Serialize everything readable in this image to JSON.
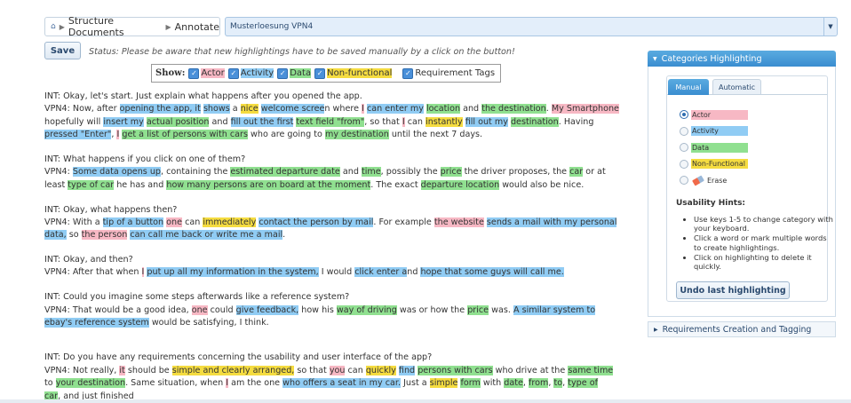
{
  "breadcrumb": {
    "home_icon": "home-icon",
    "items": [
      "Structure Documents",
      "Annotate"
    ]
  },
  "document_select": {
    "value": "Musterloesung VPN4"
  },
  "toolbar": {
    "save_label": "Save",
    "status": "Status: Please be aware that new highlightings have to be saved manually by a click on the button!"
  },
  "show": {
    "label": "Show:",
    "options": [
      "Actor",
      "Activity",
      "Data",
      "Non-functional",
      "Requirement Tags"
    ]
  },
  "colors": {
    "actor": "#f7b8c4",
    "activity": "#90ccf4",
    "data": "#90e090",
    "nonfunctional": "#f5dc40",
    "accent": "#3a8dd0"
  },
  "transcript": [
    [
      [
        "INT: Okay, let's start. Just explain what happens after you opened the app.",
        ""
      ]
    ],
    [
      [
        "VPN4: Now, after ",
        ""
      ],
      [
        "opening the app, it",
        "c"
      ],
      [
        " ",
        ""
      ],
      [
        "shows",
        "c"
      ],
      [
        " a ",
        ""
      ],
      [
        "nice",
        "n"
      ],
      [
        " ",
        ""
      ],
      [
        "welcome scree",
        "c"
      ],
      [
        "n where ",
        ""
      ],
      [
        "I",
        "a"
      ],
      [
        " ",
        ""
      ],
      [
        "can enter my",
        "c"
      ],
      [
        " ",
        ""
      ],
      [
        "location",
        "d"
      ],
      [
        " and ",
        ""
      ],
      [
        "the destination",
        "d"
      ],
      [
        ". ",
        ""
      ],
      [
        "My Smartphone",
        "a"
      ]
    ],
    [
      [
        "hopefully will ",
        ""
      ],
      [
        "insert my",
        "c"
      ],
      [
        " ",
        ""
      ],
      [
        "actual position",
        "d"
      ],
      [
        " and ",
        ""
      ],
      [
        "fill out the first",
        "c"
      ],
      [
        " ",
        ""
      ],
      [
        "text field \"from\"",
        "d"
      ],
      [
        ", so that ",
        ""
      ],
      [
        "I",
        "a"
      ],
      [
        " can ",
        ""
      ],
      [
        "instantly",
        "n"
      ],
      [
        " ",
        ""
      ],
      [
        "fill out my",
        "c"
      ],
      [
        " ",
        ""
      ],
      [
        "destination",
        "d"
      ],
      [
        ". Having",
        ""
      ]
    ],
    [
      [
        "pressed \"Enter\"",
        "c"
      ],
      [
        ", ",
        ""
      ],
      [
        "I",
        "a"
      ],
      [
        " ",
        ""
      ],
      [
        "get a list of persons with cars",
        "d"
      ],
      [
        " who are going to ",
        ""
      ],
      [
        "my destination",
        "d"
      ],
      [
        " until the next 7 days.",
        ""
      ]
    ],
    [],
    [
      [
        "INT: What happens if you click on one of them?",
        ""
      ]
    ],
    [
      [
        "VPN4: ",
        ""
      ],
      [
        "Some data opens up",
        "c"
      ],
      [
        ", containing the ",
        ""
      ],
      [
        "estimated departure date",
        "d"
      ],
      [
        " and ",
        ""
      ],
      [
        "time",
        "d"
      ],
      [
        ", possibly the ",
        ""
      ],
      [
        "price",
        "d"
      ],
      [
        " the driver proposes, the ",
        ""
      ],
      [
        "car",
        "d"
      ],
      [
        " or at",
        ""
      ]
    ],
    [
      [
        "least ",
        ""
      ],
      [
        "type of car",
        "d"
      ],
      [
        " he has and ",
        ""
      ],
      [
        "how many persons are on board at the moment",
        "d"
      ],
      [
        ". The exact ",
        ""
      ],
      [
        "departure location",
        "d"
      ],
      [
        " would also be nice.",
        ""
      ]
    ],
    [],
    [
      [
        "INT: Okay, what happens then?",
        ""
      ]
    ],
    [
      [
        "VPN4: With a ",
        ""
      ],
      [
        "tip of a button",
        "c"
      ],
      [
        " ",
        ""
      ],
      [
        "one",
        "a"
      ],
      [
        " can ",
        ""
      ],
      [
        "immediately",
        "n"
      ],
      [
        " ",
        ""
      ],
      [
        "contact the person by mail",
        "c"
      ],
      [
        ". For example ",
        ""
      ],
      [
        "the website",
        "a"
      ],
      [
        " ",
        ""
      ],
      [
        "sends a mail with my personal",
        "c"
      ]
    ],
    [
      [
        "data,",
        "c"
      ],
      [
        " so ",
        ""
      ],
      [
        "the person",
        "a"
      ],
      [
        " ",
        ""
      ],
      [
        "can call me back or write me a mail",
        "c"
      ],
      [
        ".",
        ""
      ]
    ],
    [],
    [
      [
        "INT: Okay, and then?",
        ""
      ]
    ],
    [
      [
        "VPN4: After that when ",
        ""
      ],
      [
        "I",
        "a"
      ],
      [
        " ",
        ""
      ],
      [
        "put up all my information in the system,",
        "c"
      ],
      [
        " I would ",
        ""
      ],
      [
        "click enter a",
        "c"
      ],
      [
        "nd ",
        ""
      ],
      [
        "hope that some guys will call me.",
        "c"
      ]
    ],
    [],
    [
      [
        "INT: Could you imagine some steps afterwards like a reference system?",
        ""
      ]
    ],
    [
      [
        "VPN4: That would be a good idea, ",
        ""
      ],
      [
        "one",
        "a"
      ],
      [
        " could ",
        ""
      ],
      [
        "give feedback,",
        "c"
      ],
      [
        " how his ",
        ""
      ],
      [
        "way of driving",
        "d"
      ],
      [
        " was or how the ",
        ""
      ],
      [
        "price",
        "d"
      ],
      [
        " was. ",
        ""
      ],
      [
        "A similar system to",
        "c"
      ]
    ],
    [
      [
        "ebay's reference system",
        "c"
      ],
      [
        " would be satisfying, I think.",
        ""
      ]
    ],
    [],
    [
      [
        "INT: Do you have any requirements concerning the usability and user interface of the app?",
        ""
      ]
    ],
    [
      [
        "VPN4: Not really, ",
        ""
      ],
      [
        "it",
        "a"
      ],
      [
        " should be ",
        ""
      ],
      [
        "simple and clearly arranged,",
        "n"
      ],
      [
        " so that ",
        ""
      ],
      [
        "you",
        "a"
      ],
      [
        " can ",
        ""
      ],
      [
        "quickly",
        "n"
      ],
      [
        " ",
        ""
      ],
      [
        "find",
        "c"
      ],
      [
        " ",
        ""
      ],
      [
        "persons with cars",
        "d"
      ],
      [
        " who drive at the ",
        ""
      ],
      [
        "same time",
        "d"
      ]
    ],
    [
      [
        "to ",
        ""
      ],
      [
        "your destination",
        "d"
      ],
      [
        ". Same situation, when ",
        ""
      ],
      [
        "I",
        "a"
      ],
      [
        " am the one ",
        ""
      ],
      [
        "who offers a seat in my car.",
        "c"
      ],
      [
        " Just a ",
        ""
      ],
      [
        "simple",
        "n"
      ],
      [
        " ",
        ""
      ],
      [
        "form",
        "d"
      ],
      [
        " with ",
        ""
      ],
      [
        "date",
        "d"
      ],
      [
        ", ",
        ""
      ],
      [
        "from",
        "d"
      ],
      [
        ", ",
        ""
      ],
      [
        "to",
        "d"
      ],
      [
        ", ",
        ""
      ],
      [
        "type of",
        "d"
      ]
    ],
    [
      [
        "car",
        "d"
      ],
      [
        ", and just finished",
        ""
      ]
    ]
  ],
  "panel": {
    "title": "Categories Highlighting",
    "tab_manual": "Manual",
    "tab_automatic": "Automatic",
    "radios": [
      "Actor",
      "Activity",
      "Data",
      "Non-Functional",
      "Erase"
    ],
    "hints_title": "Usability Hints:",
    "hints": [
      "Use keys 1-5 to change category with your keyboard.",
      "Click a word or mark multiple words to create highlightings.",
      "Click on highlighting to delete it quickly."
    ],
    "undo_label": "Undo last highlighting"
  },
  "panel2": {
    "title": "Requirements Creation and Tagging"
  }
}
